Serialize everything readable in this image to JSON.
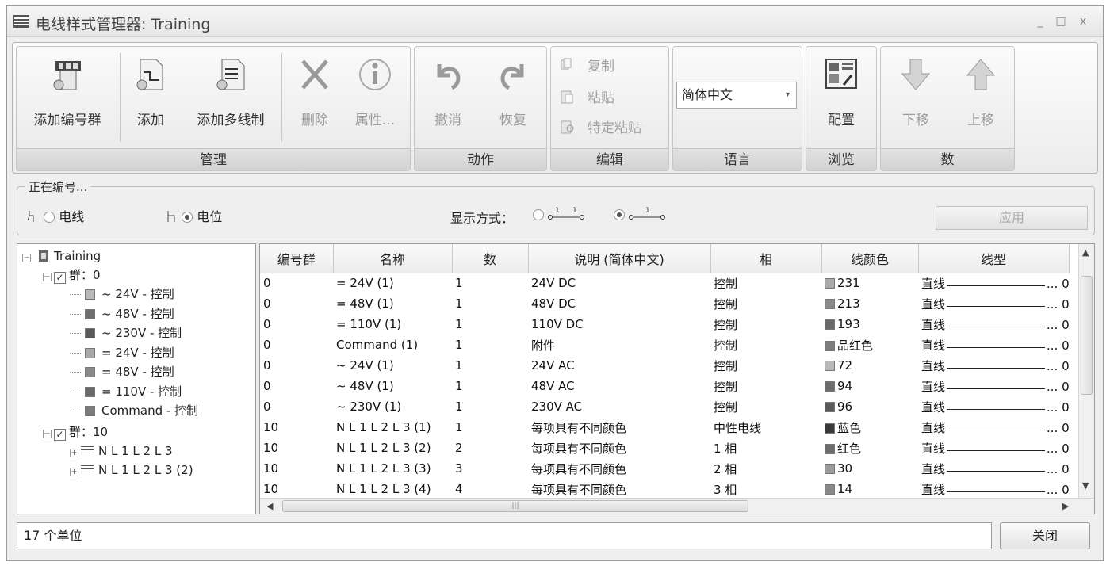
{
  "window": {
    "title": "电线样式管理器: Training",
    "minimize": "_",
    "maximize": "□",
    "close": "x"
  },
  "ribbon": {
    "manage": {
      "caption": "管理",
      "add_group": "添加编号群",
      "add": "添加",
      "add_multi": "添加多线制",
      "delete": "删除",
      "properties": "属性..."
    },
    "actions": {
      "caption": "动作",
      "undo": "撤消",
      "redo": "恢复"
    },
    "edit": {
      "caption": "编辑",
      "copy": "复制",
      "paste": "粘贴",
      "paste_special": "特定粘贴"
    },
    "language": {
      "caption": "语言",
      "selected": "简体中文"
    },
    "browse": {
      "caption": "浏览",
      "config": "配置"
    },
    "number": {
      "caption": "数",
      "move_down": "下移",
      "move_up": "上移"
    }
  },
  "numbering": {
    "legend": "正在编号...",
    "wire": "电线",
    "potential": "电位",
    "display_mode": "显示方式：",
    "apply": "应用"
  },
  "tree": {
    "root": "Training",
    "group0": "群：0",
    "group0_items": [
      {
        "label": "~ 24V - 控制",
        "color": "#b8b8b8"
      },
      {
        "label": "~ 48V - 控制",
        "color": "#6e6e6e"
      },
      {
        "label": "~ 230V - 控制",
        "color": "#5a5a5a"
      },
      {
        "label": "= 24V - 控制",
        "color": "#a9a9a9"
      },
      {
        "label": "= 48V - 控制",
        "color": "#8a8a8a"
      },
      {
        "label": "= 110V - 控制",
        "color": "#6a6a6a"
      },
      {
        "label": "Command - 控制",
        "color": "#7c7c7c"
      }
    ],
    "group10": "群：10",
    "group10_items": [
      "N L 1 L 2 L 3",
      "N L 1 L 2 L 3 (2)"
    ]
  },
  "grid": {
    "columns": [
      "编号群",
      "名称",
      "数",
      "说明 (简体中文)",
      "相",
      "线颜色",
      "线型"
    ],
    "rows": [
      {
        "group": "0",
        "name": "= 24V (1)",
        "num": "1",
        "desc": "24V DC",
        "phase": "控制",
        "color": "231",
        "swatch": "#a9a9a9",
        "type": "直线",
        "end": "... 0"
      },
      {
        "group": "0",
        "name": "= 48V (1)",
        "num": "1",
        "desc": "48V DC",
        "phase": "控制",
        "color": "213",
        "swatch": "#8a8a8a",
        "type": "直线",
        "end": "... 0"
      },
      {
        "group": "0",
        "name": "= 110V (1)",
        "num": "1",
        "desc": "110V DC",
        "phase": "控制",
        "color": "193",
        "swatch": "#6a6a6a",
        "type": "直线",
        "end": "... 0"
      },
      {
        "group": "0",
        "name": "Command (1)",
        "num": "1",
        "desc": "附件",
        "phase": "控制",
        "color": "品红色",
        "swatch": "#7c7c7c",
        "type": "直线",
        "end": "... 0"
      },
      {
        "group": "0",
        "name": "~ 24V (1)",
        "num": "1",
        "desc": "24V AC",
        "phase": "控制",
        "color": "72",
        "swatch": "#b8b8b8",
        "type": "直线",
        "end": "... 0"
      },
      {
        "group": "0",
        "name": "~ 48V (1)",
        "num": "1",
        "desc": "48V AC",
        "phase": "控制",
        "color": "94",
        "swatch": "#6e6e6e",
        "type": "直线",
        "end": "... 0"
      },
      {
        "group": "0",
        "name": "~ 230V (1)",
        "num": "1",
        "desc": "230V AC",
        "phase": "控制",
        "color": "96",
        "swatch": "#5a5a5a",
        "type": "直线",
        "end": "... 0"
      },
      {
        "group": "10",
        "name": "N L 1 L 2 L 3 (1)",
        "num": "1",
        "desc": "每项具有不同颜色",
        "phase": "中性电线",
        "color": "蓝色",
        "swatch": "#3a3a3a",
        "type": "直线",
        "end": "... 0"
      },
      {
        "group": "10",
        "name": "N L 1 L 2 L 3 (2)",
        "num": "2",
        "desc": "每项具有不同颜色",
        "phase": "1 相",
        "color": "红色",
        "swatch": "#6c6c6c",
        "type": "直线",
        "end": "... 0"
      },
      {
        "group": "10",
        "name": "N L 1 L 2 L 3 (3)",
        "num": "3",
        "desc": "每项具有不同颜色",
        "phase": "2 相",
        "color": "30",
        "swatch": "#9a9a9a",
        "type": "直线",
        "end": "... 0"
      },
      {
        "group": "10",
        "name": "N L 1 L 2 L 3 (4)",
        "num": "4",
        "desc": "每项具有不同颜色",
        "phase": "3 相",
        "color": "14",
        "swatch": "#888888",
        "type": "直线",
        "end": "... 0"
      }
    ]
  },
  "status": {
    "count": "17 个单位",
    "close": "关闭"
  }
}
